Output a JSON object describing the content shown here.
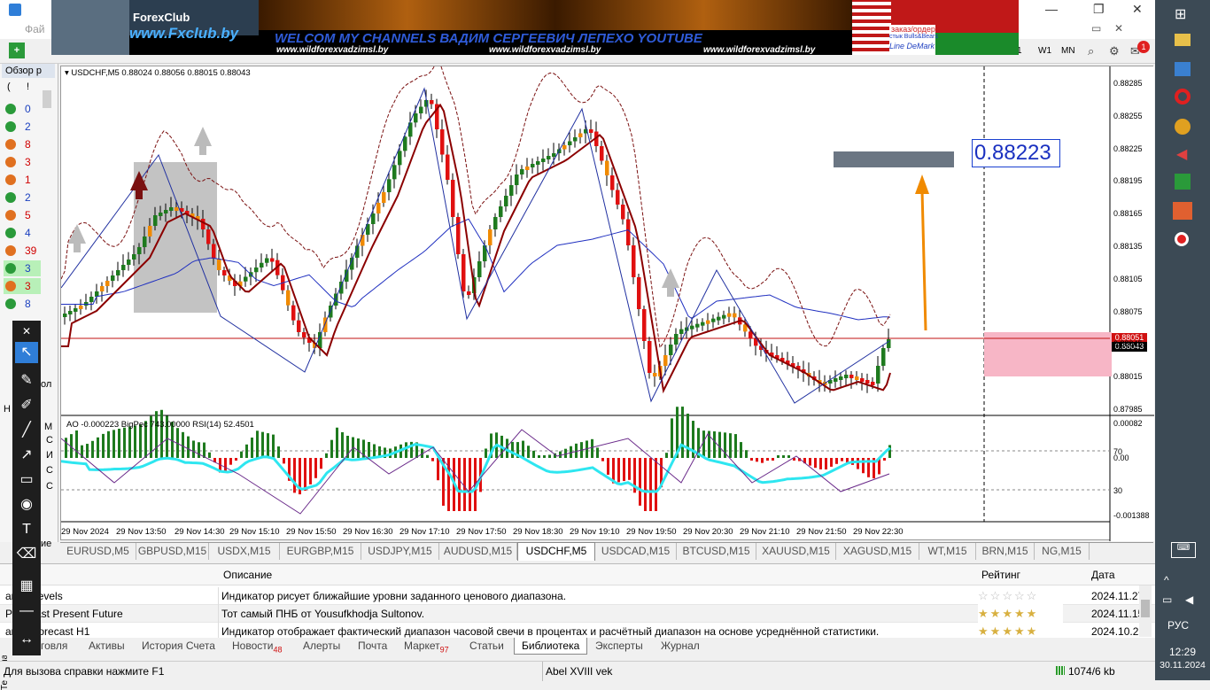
{
  "window": {
    "title_abbrev": "Фай",
    "controls": [
      "—",
      "❐",
      "✕"
    ]
  },
  "banner": {
    "logo_brand": "ForexClub",
    "logo_url": "www.Fxclub.by",
    "headline": "WELCOM MY CHANNELS ВАДИМ СЕРГЕЕВИЧ ЛЕПЕХО YOUTUBE",
    "urls": [
      "www.wildforexvadzimsl.by",
      "www.wildforexvadzimsl.by",
      "www.wildforexvadzimsl.by"
    ],
    "right_lines": [
      "заказ/ордер",
      "стык Bulls&Bears",
      "Line DeMark"
    ]
  },
  "toolbar": {
    "timeframes": [
      "1",
      "W1",
      "MN"
    ],
    "notif_count": "1"
  },
  "market_watch": {
    "title": "Обзор р",
    "header": [
      "(",
      "!"
    ],
    "rows": [
      {
        "value": "0",
        "color": "#1a3fbf"
      },
      {
        "value": "2",
        "color": "#1a3fbf"
      },
      {
        "value": "8",
        "color": "#d00000"
      },
      {
        "value": "3",
        "color": "#d00000"
      },
      {
        "value": "1",
        "color": "#d00000"
      },
      {
        "value": "2",
        "color": "#1a3fbf"
      },
      {
        "value": "5",
        "color": "#d00000"
      },
      {
        "value": "4",
        "color": "#1a3fbf"
      },
      {
        "value": "39",
        "color": "#d00000"
      },
      {
        "value": "3",
        "color": "#1a3fbf"
      },
      {
        "value": "3",
        "color": "#d00000"
      },
      {
        "value": "8",
        "color": "#1a3fbf"
      }
    ],
    "bottom_labels": [
      "ол",
      "Н",
      "М",
      "С",
      "И",
      "С",
      "С",
      "ие"
    ]
  },
  "chart": {
    "symbol_info": "USDCHF,M5  0.88024 0.88056 0.88015 0.88043",
    "target_label": "0.88223",
    "current_price_1": "0.88051",
    "current_price_2": "0.88043",
    "price_ticks": [
      "0.88285",
      "0.88255",
      "0.88225",
      "0.88195",
      "0.88165",
      "0.88135",
      "0.88105",
      "0.88075",
      "0.88045",
      "0.88015",
      "0.87985"
    ],
    "indicator_info": "AO -0.000223  BigPec 743.00000  RSI(14) 52.4501",
    "indicator_ticks": [
      "0.00082",
      "70",
      "0.00",
      "30",
      "-0.001388"
    ],
    "time_ticks": [
      "29 Nov 2024",
      "29 Nov 13:50",
      "29 Nov 14:30",
      "29 Nov 15:10",
      "29 Nov 15:50",
      "29 Nov 16:30",
      "29 Nov 17:10",
      "29 Nov 17:50",
      "29 Nov 18:30",
      "29 Nov 19:10",
      "29 Nov 19:50",
      "29 Nov 20:30",
      "29 Nov 21:10",
      "29 Nov 21:50",
      "29 Nov 22:30"
    ],
    "colors": {
      "bull": "#1e7a1e",
      "bear": "#e01010",
      "orange": "#f08a00",
      "ma_fast": "#8b0000",
      "ma_slow": "#2030c0",
      "rsi": "#2ee6f0",
      "band": "#7a1010"
    }
  },
  "chart_tabs": [
    "EURUSD,M5",
    "GBPUSD,M15",
    "USDX,M15",
    "EURGBP,M15",
    "USDJPY,M15",
    "AUDUSD,M15",
    "USDCHF,M5",
    "USDCAD,M15",
    "BTCUSD,M15",
    "XAUUSD,M15",
    "XAGUSD,M15",
    "WT,M15",
    "BRN,M15",
    "NG,M15"
  ],
  "chart_tabs_active": "USDCHF,M5",
  "terminal": {
    "columns": {
      "description": "Описание",
      "rating": "Рейтинг",
      "date": "Дата"
    },
    "rows": [
      {
        "name": "ange Levels",
        "description": "Индикатор рисует ближайшие уровни заданного ценового диапазона.",
        "stars": 0,
        "date": "2024.11.27"
      },
      {
        "name": "PF - Past Present Future",
        "description": "Тот самый ПНБ от Yousufkhodja Sultonov.",
        "stars": 5,
        "date": "2024.11.15"
      },
      {
        "name": "ange Forecast H1",
        "description": "Индикатор отображает фактический диапазон часовой свечи в процентах и расчётный диапазон на основе усреднённой статистики.",
        "stars": 5,
        "date": "2024.10.25"
      }
    ],
    "side_label": "Терминал",
    "tabs": [
      {
        "label": "говля",
        "badge": ""
      },
      {
        "label": "Активы",
        "badge": ""
      },
      {
        "label": "История Счета",
        "badge": ""
      },
      {
        "label": "Новости",
        "badge": "48"
      },
      {
        "label": "Алерты",
        "badge": ""
      },
      {
        "label": "Почта",
        "badge": ""
      },
      {
        "label": "Маркет",
        "badge": "97"
      },
      {
        "label": "Статьи",
        "badge": ""
      },
      {
        "label": "Библиотека",
        "badge": ""
      },
      {
        "label": "Эксперты",
        "badge": ""
      },
      {
        "label": "Журнал",
        "badge": ""
      }
    ],
    "active_tab": "Библиотека"
  },
  "status": {
    "help": "Для вызова справки нажмите F1",
    "profile": "Abel XVIII vek",
    "traffic": "1074/6 kb"
  },
  "taskbar": {
    "lang": "РУС",
    "time": "12:29",
    "date": "30.11.2024"
  }
}
